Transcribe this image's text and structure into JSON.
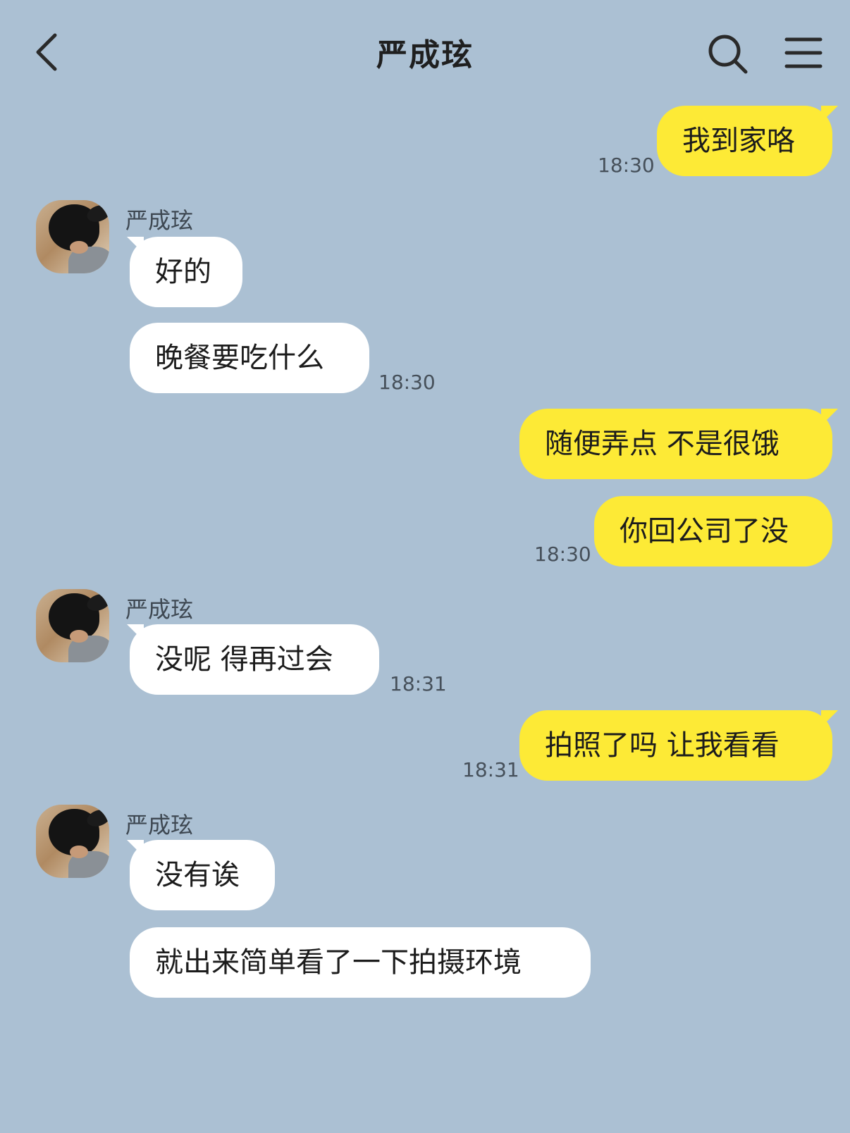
{
  "header": {
    "title": "严成玹",
    "back_icon": "chevron-left-icon",
    "search_icon": "search-icon",
    "menu_icon": "menu-icon"
  },
  "colors": {
    "background": "#abc0d3",
    "incoming_bubble": "#ffffff",
    "outgoing_bubble": "#fdea36"
  },
  "messages": [
    {
      "direction": "out",
      "text": "我到家咯",
      "time": "18:30"
    },
    {
      "direction": "in",
      "sender": "严成玹",
      "text": "好的"
    },
    {
      "direction": "in",
      "text": "晚餐要吃什么",
      "time": "18:30"
    },
    {
      "direction": "out",
      "text": "随便弄点 不是很饿"
    },
    {
      "direction": "out",
      "text": "你回公司了没",
      "time": "18:30"
    },
    {
      "direction": "in",
      "sender": "严成玹",
      "text": "没呢 得再过会",
      "time": "18:31"
    },
    {
      "direction": "out",
      "text": "拍照了吗 让我看看",
      "time": "18:31"
    },
    {
      "direction": "in",
      "sender": "严成玹",
      "text": "没有诶"
    },
    {
      "direction": "in",
      "text": "就出来简单看了一下拍摄环境"
    }
  ]
}
